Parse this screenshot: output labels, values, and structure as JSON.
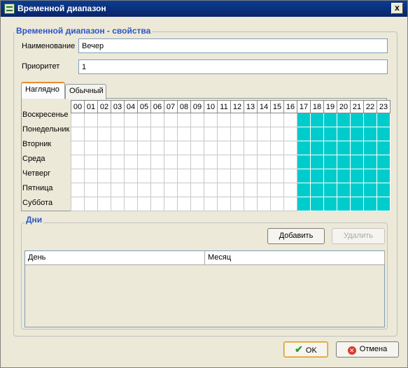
{
  "window": {
    "title": "Временной диапазон",
    "close_label": "x"
  },
  "properties": {
    "legend": "Временной диапазон - свойства",
    "name_label": "Наименование",
    "name_value": "Вечер",
    "priority_label": "Приоритет",
    "priority_value": "1"
  },
  "tabs": [
    {
      "label": "Наглядно",
      "active": true
    },
    {
      "label": "Обычный",
      "active": false
    }
  ],
  "schedule": {
    "hours": [
      "00",
      "01",
      "02",
      "03",
      "04",
      "05",
      "06",
      "07",
      "08",
      "09",
      "10",
      "11",
      "12",
      "13",
      "14",
      "15",
      "16",
      "17",
      "18",
      "19",
      "20",
      "21",
      "22",
      "23"
    ],
    "days": [
      "Воскресенье",
      "Понедельник",
      "Вторник",
      "Среда",
      "Четверг",
      "Пятница",
      "Суббота"
    ],
    "active_from_hour": 17,
    "active_to_hour": 23,
    "active_color": "#00cccc"
  },
  "days_section": {
    "legend": "Дни",
    "add_label": "Добавить",
    "delete_label": "Удалить",
    "columns": [
      "День",
      "Месяц"
    ],
    "rows": []
  },
  "footer": {
    "ok_label": "OK",
    "cancel_label": "Отмена",
    "ok_icon": "checkmark-icon",
    "cancel_icon": "cancel-icon"
  }
}
